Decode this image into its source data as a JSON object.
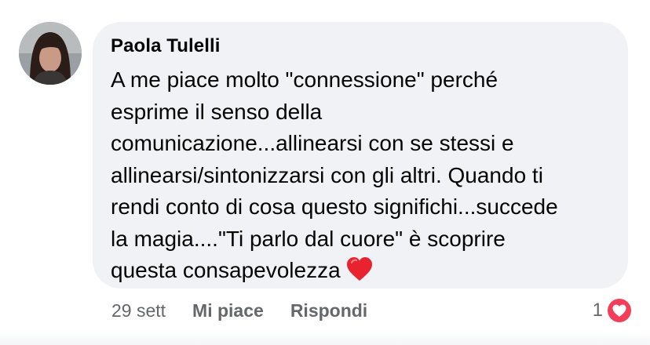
{
  "comment": {
    "author": "Paola Tulelli",
    "text_lines": [
      "A me piace molto \"connessione\" perché",
      "esprime il senso della",
      "comunicazione...allinearsi con se stessi e",
      "allinearsi/sintonizzarsi con gli altri. Quando ti",
      "rendi conto di cosa questo significhi...succede",
      "la magia....\"Ti parlo dal cuore\" è scoprire",
      "questa consapevolezza"
    ],
    "emoji": "heart-emoji",
    "timestamp": "29 sett",
    "like_label": "Mi piace",
    "reply_label": "Rispondi",
    "reaction_count": "1",
    "reaction_type": "love-icon"
  },
  "colors": {
    "bubble_bg": "#f0f2f5",
    "text": "#050505",
    "secondary_text": "#65676b",
    "love_red": "#f33e58"
  }
}
